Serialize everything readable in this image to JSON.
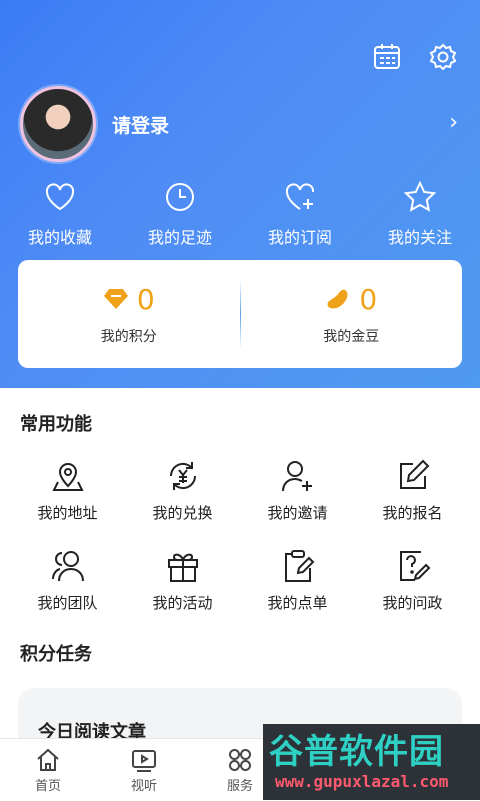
{
  "header": {
    "login_text": "请登录",
    "quick_links": [
      {
        "label": "我的收藏",
        "icon": "heart-icon"
      },
      {
        "label": "我的足迹",
        "icon": "clock-icon"
      },
      {
        "label": "我的订阅",
        "icon": "heart-plus-icon"
      },
      {
        "label": "我的关注",
        "icon": "star-icon"
      }
    ]
  },
  "stats": {
    "points": {
      "value": "0",
      "label": "我的积分",
      "icon": "diamond-icon"
    },
    "beans": {
      "value": "0",
      "label": "我的金豆",
      "icon": "bean-icon"
    }
  },
  "common": {
    "title": "常用功能",
    "items": [
      {
        "label": "我的地址",
        "icon": "location-icon"
      },
      {
        "label": "我的兑换",
        "icon": "exchange-icon"
      },
      {
        "label": "我的邀请",
        "icon": "add-user-icon"
      },
      {
        "label": "我的报名",
        "icon": "edit-icon"
      },
      {
        "label": "我的团队",
        "icon": "team-icon"
      },
      {
        "label": "我的活动",
        "icon": "gift-icon"
      },
      {
        "label": "我的点单",
        "icon": "clipboard-edit-icon"
      },
      {
        "label": "我的问政",
        "icon": "question-edit-icon"
      }
    ]
  },
  "tasks": {
    "title": "积分任务",
    "first_task": "今日阅读文章"
  },
  "tabbar": {
    "items": [
      {
        "label": "首页",
        "icon": "home-icon"
      },
      {
        "label": "视听",
        "icon": "video-icon"
      },
      {
        "label": "服务",
        "icon": "apps-icon"
      }
    ]
  },
  "watermark": {
    "title": "谷普软件园",
    "url": "www.gupuxlazal.com"
  },
  "colors": {
    "header_start": "#3a7cf6",
    "header_end": "#4f9bf0",
    "accent_gold": "#f0a21a"
  }
}
